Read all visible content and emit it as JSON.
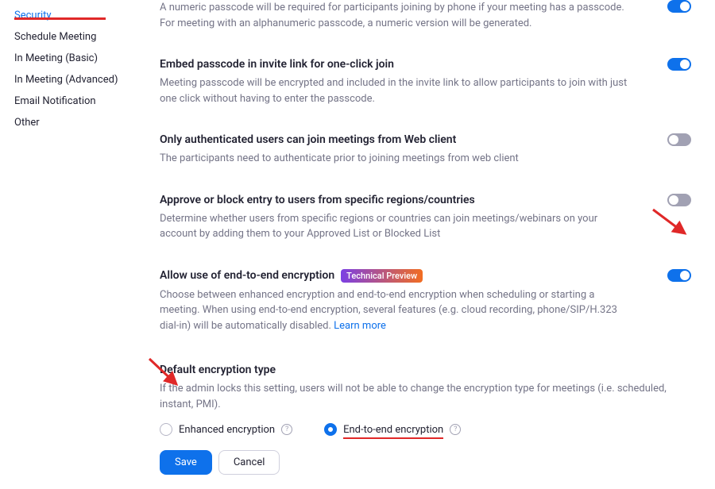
{
  "sidebar": {
    "items": [
      {
        "label": "Security"
      },
      {
        "label": "Schedule Meeting"
      },
      {
        "label": "In Meeting (Basic)"
      },
      {
        "label": "In Meeting (Advanced)"
      },
      {
        "label": "Email Notification"
      },
      {
        "label": "Other"
      }
    ]
  },
  "settings": {
    "passcode_numeric": {
      "desc": "A numeric passcode will be required for participants joining by phone if your meeting has a passcode. For meeting with an alphanumeric passcode, a numeric version will be generated.",
      "toggle": "on"
    },
    "embed_passcode": {
      "title": "Embed passcode in invite link for one-click join",
      "desc": "Meeting passcode will be encrypted and included in the invite link to allow participants to join with just one click without having to enter the passcode.",
      "toggle": "on"
    },
    "auth_web": {
      "title": "Only authenticated users can join meetings from Web client",
      "desc": "The participants need to authenticate prior to joining meetings from web client",
      "toggle": "off"
    },
    "region_block": {
      "title": "Approve or block entry to users from specific regions/countries",
      "desc": "Determine whether users from specific regions or countries can join meetings/webinars on your account by adding them to your Approved List or Blocked List",
      "toggle": "off"
    },
    "e2ee": {
      "title": "Allow use of end-to-end encryption",
      "badge": "Technical Preview",
      "desc_pre": "Choose between enhanced encryption and end-to-end encryption when scheduling or starting a meeting. When using end-to-end encryption, several features (e.g. cloud recording, phone/SIP/H.323 dial-in) will be automatically disabled. ",
      "learn_more": "Learn more",
      "toggle": "on"
    },
    "default_enc": {
      "title": "Default encryption type",
      "desc": "If the admin locks this setting, users will not be able to change the encryption type for meetings (i.e. scheduled, instant, PMI).",
      "options": {
        "enhanced": "Enhanced encryption",
        "e2e": "End-to-end encryption"
      },
      "selected": "e2e",
      "save": "Save",
      "cancel": "Cancel"
    }
  },
  "colors": {
    "accent": "#0E71EB",
    "annotation": "#E02828"
  }
}
